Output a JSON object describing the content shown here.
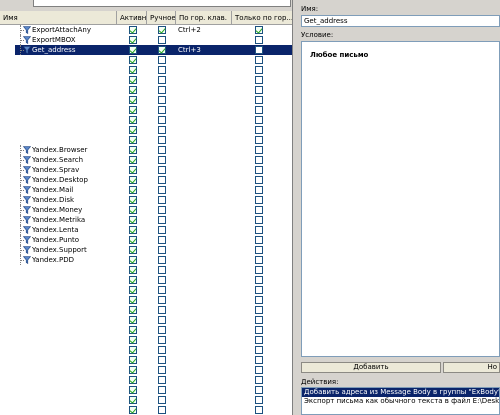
{
  "columns": {
    "name": "Имя",
    "active": "Активно",
    "manual": "Ручное",
    "hotkey": "По гор. клав.",
    "only": "Только по гор..."
  },
  "rules": [
    {
      "name": "ExportAttachAny",
      "active": true,
      "manual": true,
      "hotkey": "Ctrl+2",
      "only": true
    },
    {
      "name": "ExportMBOX",
      "active": true,
      "manual": false,
      "hotkey": "",
      "only": false
    },
    {
      "name": "Get_address",
      "active": true,
      "manual": true,
      "hotkey": "Ctrl+3",
      "only": false,
      "selected": true
    },
    {
      "name": "",
      "active": true,
      "manual": false,
      "hotkey": "",
      "only": false
    },
    {
      "name": "",
      "active": true,
      "manual": false,
      "hotkey": "",
      "only": false
    },
    {
      "name": "",
      "active": true,
      "manual": false,
      "hotkey": "",
      "only": false
    },
    {
      "name": "",
      "active": true,
      "manual": false,
      "hotkey": "",
      "only": false
    },
    {
      "name": "",
      "active": true,
      "manual": false,
      "hotkey": "",
      "only": false
    },
    {
      "name": "",
      "active": true,
      "manual": false,
      "hotkey": "",
      "only": false
    },
    {
      "name": "",
      "active": true,
      "manual": false,
      "hotkey": "",
      "only": false
    },
    {
      "name": "",
      "active": true,
      "manual": false,
      "hotkey": "",
      "only": false
    },
    {
      "name": "",
      "active": true,
      "manual": false,
      "hotkey": "",
      "only": false
    },
    {
      "name": "Yandex.Browser",
      "active": true,
      "manual": false,
      "hotkey": "",
      "only": false
    },
    {
      "name": "Yandex.Search",
      "active": true,
      "manual": false,
      "hotkey": "",
      "only": false
    },
    {
      "name": "Yandex.Sprav",
      "active": true,
      "manual": false,
      "hotkey": "",
      "only": false
    },
    {
      "name": "Yandex.Desktop",
      "active": true,
      "manual": false,
      "hotkey": "",
      "only": false
    },
    {
      "name": "Yandex.Mail",
      "active": true,
      "manual": false,
      "hotkey": "",
      "only": false
    },
    {
      "name": "Yandex.Disk",
      "active": true,
      "manual": false,
      "hotkey": "",
      "only": false
    },
    {
      "name": "Yandex.Money",
      "active": true,
      "manual": false,
      "hotkey": "",
      "only": false
    },
    {
      "name": "Yandex.Metrika",
      "active": true,
      "manual": false,
      "hotkey": "",
      "only": false
    },
    {
      "name": "Yandex.Lenta",
      "active": true,
      "manual": false,
      "hotkey": "",
      "only": false
    },
    {
      "name": "Yandex.Punto",
      "active": true,
      "manual": false,
      "hotkey": "",
      "only": false
    },
    {
      "name": "Yandex.Support",
      "active": true,
      "manual": false,
      "hotkey": "",
      "only": false
    },
    {
      "name": "Yandex.PDD",
      "active": true,
      "manual": false,
      "hotkey": "",
      "only": false
    },
    {
      "name": "",
      "active": true,
      "manual": false,
      "hotkey": "",
      "only": false
    },
    {
      "name": "",
      "active": true,
      "manual": false,
      "hotkey": "",
      "only": false
    },
    {
      "name": "",
      "active": true,
      "manual": false,
      "hotkey": "",
      "only": false
    },
    {
      "name": "",
      "active": true,
      "manual": false,
      "hotkey": "",
      "only": false
    },
    {
      "name": "",
      "active": true,
      "manual": false,
      "hotkey": "",
      "only": false
    },
    {
      "name": "",
      "active": true,
      "manual": false,
      "hotkey": "",
      "only": false
    },
    {
      "name": "",
      "active": true,
      "manual": false,
      "hotkey": "",
      "only": false
    },
    {
      "name": "",
      "active": true,
      "manual": false,
      "hotkey": "",
      "only": false
    },
    {
      "name": "",
      "active": true,
      "manual": false,
      "hotkey": "",
      "only": false
    },
    {
      "name": "",
      "active": true,
      "manual": false,
      "hotkey": "",
      "only": false
    },
    {
      "name": "",
      "active": true,
      "manual": false,
      "hotkey": "",
      "only": false
    },
    {
      "name": "",
      "active": true,
      "manual": false,
      "hotkey": "",
      "only": false
    },
    {
      "name": "",
      "active": true,
      "manual": false,
      "hotkey": "",
      "only": false
    },
    {
      "name": "",
      "active": true,
      "manual": false,
      "hotkey": "",
      "only": false
    },
    {
      "name": "",
      "active": true,
      "manual": false,
      "hotkey": "",
      "only": false
    }
  ],
  "detail": {
    "name_label": "Имя:",
    "name_value": "Get_address",
    "condition_label": "Условие:",
    "condition_value": "Любое письмо",
    "add_button": "Добавить",
    "second_button": "Но",
    "actions_label": "Действия:",
    "actions": [
      {
        "text": "Добавить адреса из Message Body в группы \"ExBody\"",
        "selected": true
      },
      {
        "text": "Экспорт письма как обычного текста в файл E:\\Desktop\\!!!.txt",
        "selected": false
      }
    ]
  },
  "colors": {
    "selection": "#0a246a",
    "check": "#21a121",
    "panel": "#d6d3ce"
  },
  "icons": {
    "rule": "filter-icon"
  }
}
